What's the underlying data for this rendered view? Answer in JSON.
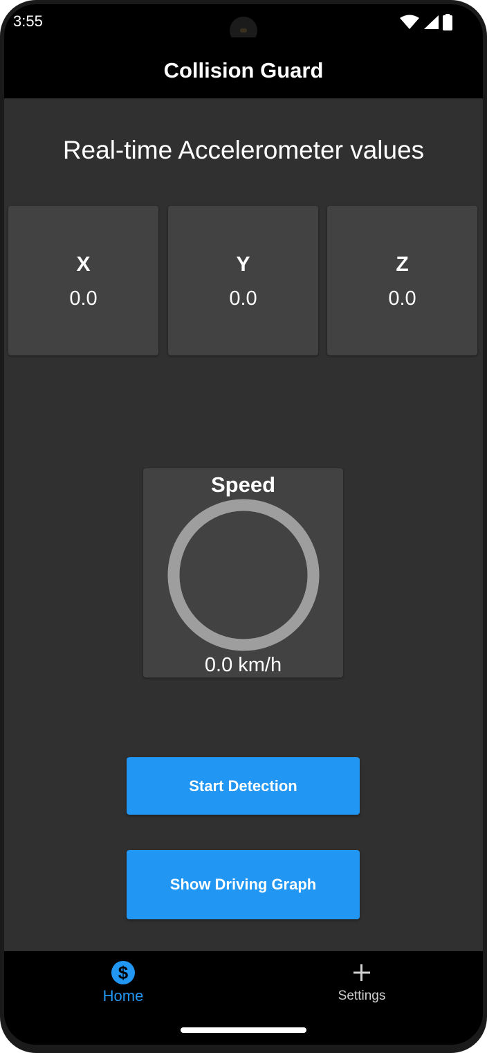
{
  "status_bar": {
    "time": "3:55",
    "icons": [
      "wifi-icon",
      "cell-signal-icon",
      "battery-icon"
    ]
  },
  "app_bar": {
    "title": "Collision Guard"
  },
  "main": {
    "section_title": "Real-time Accelerometer values",
    "axes": [
      {
        "label": "X",
        "value": "0.0"
      },
      {
        "label": "Y",
        "value": "0.0"
      },
      {
        "label": "Z",
        "value": "0.0"
      }
    ],
    "speed": {
      "title": "Speed",
      "value_text": "0.0 km/h",
      "gauge_fraction": 0
    },
    "buttons": {
      "start_detection": "Start Detection",
      "show_graph": "Show Driving Graph"
    }
  },
  "bottom_nav": {
    "items": [
      {
        "label": "Home",
        "icon": "dollar-circle-icon",
        "active": true
      },
      {
        "label": "Settings",
        "icon": "plus-icon",
        "active": false
      }
    ]
  },
  "colors": {
    "accent": "#2196f3",
    "background": "#303030",
    "card": "#424242",
    "app_bar": "#000000"
  }
}
